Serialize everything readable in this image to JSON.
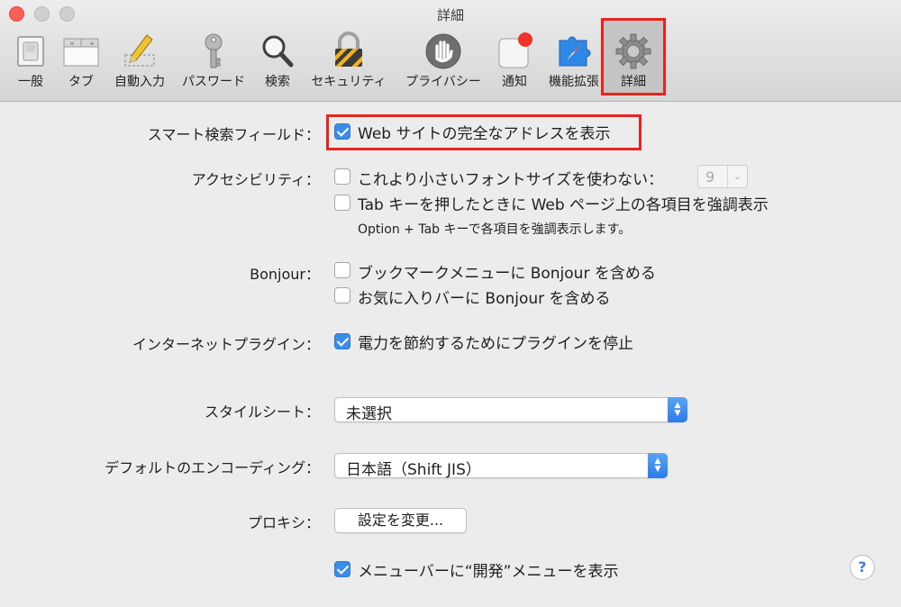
{
  "window": {
    "title": "詳細"
  },
  "toolbar": {
    "items": [
      {
        "label": "一般",
        "icon": "switch-icon"
      },
      {
        "label": "タブ",
        "icon": "tabs-icon"
      },
      {
        "label": "自動入力",
        "icon": "pencil-icon"
      },
      {
        "label": "パスワード",
        "icon": "key-icon"
      },
      {
        "label": "検索",
        "icon": "magnifier-icon"
      },
      {
        "label": "セキュリティ",
        "icon": "padlock-icon"
      },
      {
        "label": "プライバシー",
        "icon": "hand-icon"
      },
      {
        "label": "通知",
        "icon": "notification-icon"
      },
      {
        "label": "機能拡張",
        "icon": "puzzle-compass-icon"
      },
      {
        "label": "詳細",
        "icon": "gear-icon",
        "selected": true
      }
    ]
  },
  "smart_search": {
    "label": "スマート検索フィールド：",
    "option": "Web サイトの完全なアドレスを表示",
    "checked": true
  },
  "accessibility": {
    "label": "アクセシビリティ：",
    "option_fontsize": "これより小さいフォントサイズを使わない：",
    "option_fontsize_checked": false,
    "fontsize_value": "9",
    "option_tab": "Tab キーを押したときに Web ページ上の各項目を強調表示",
    "option_tab_checked": false,
    "note": "Option + Tab キーで各項目を強調表示します。"
  },
  "bonjour": {
    "label": "Bonjour：",
    "option_bookmarks_menu": "ブックマークメニューに Bonjour を含める",
    "option_bookmarks_menu_checked": false,
    "option_favorites_bar": "お気に入りバーに Bonjour を含める",
    "option_favorites_bar_checked": false
  },
  "plugins": {
    "label": "インターネットプラグイン：",
    "option": "電力を節約するためにプラグインを停止",
    "checked": true
  },
  "stylesheet": {
    "label": "スタイルシート：",
    "value": "未選択"
  },
  "encoding": {
    "label": "デフォルトのエンコーディング：",
    "value": "日本語（Shift JIS）"
  },
  "proxy": {
    "label": "プロキシ：",
    "button": "設定を変更..."
  },
  "develop_menu": {
    "option": "メニューバーに“開発”メニューを表示",
    "checked": true
  },
  "help": {
    "glyph": "?"
  },
  "colors": {
    "highlight_red": "#e8231e",
    "checkbox_blue": "#3b8ee8",
    "background": "#ececec"
  }
}
